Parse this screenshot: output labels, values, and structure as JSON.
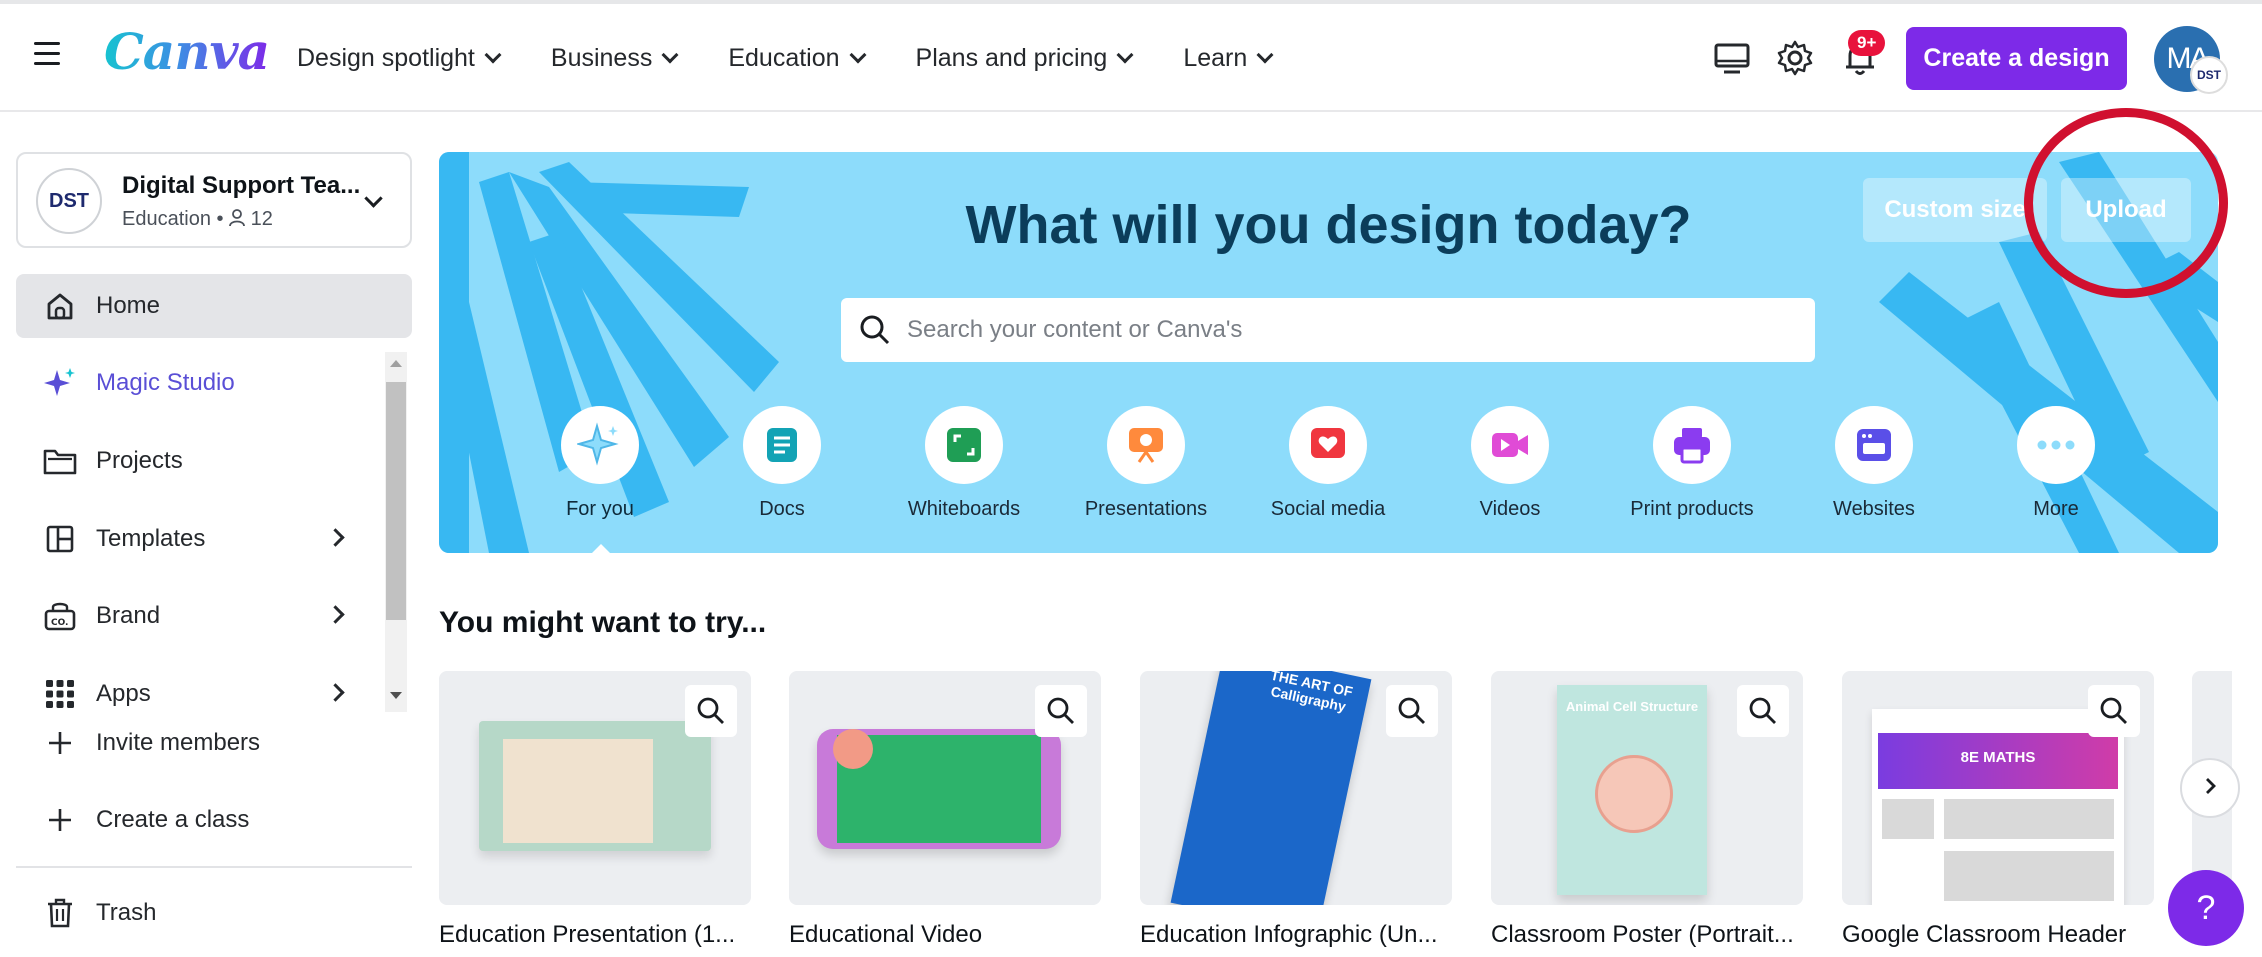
{
  "header": {
    "logo": "Canva",
    "nav": [
      {
        "label": "Design spotlight"
      },
      {
        "label": "Business"
      },
      {
        "label": "Education"
      },
      {
        "label": "Plans and pricing"
      },
      {
        "label": "Learn"
      }
    ],
    "notification_count": "9+",
    "create_label": "Create a design",
    "avatar_initials": "MA",
    "avatar_badge": "DST"
  },
  "sidebar": {
    "team": {
      "logo_text": "DST",
      "name": "Digital Support Tea...",
      "type": "Education",
      "members": "12"
    },
    "items": [
      {
        "label": "Home"
      },
      {
        "label": "Magic Studio"
      },
      {
        "label": "Projects"
      },
      {
        "label": "Templates"
      },
      {
        "label": "Brand"
      },
      {
        "label": "Apps"
      },
      {
        "label": "Invite members"
      },
      {
        "label": "Create a class"
      },
      {
        "label": "Trash"
      }
    ]
  },
  "hero": {
    "title": "What will you design today?",
    "search_placeholder": "Search your content or Canva's",
    "custom_size_label": "Custom size",
    "upload_label": "Upload",
    "categories": [
      {
        "label": "For you"
      },
      {
        "label": "Docs"
      },
      {
        "label": "Whiteboards"
      },
      {
        "label": "Presentations"
      },
      {
        "label": "Social media"
      },
      {
        "label": "Videos"
      },
      {
        "label": "Print products"
      },
      {
        "label": "Websites"
      },
      {
        "label": "More"
      }
    ]
  },
  "suggestions": {
    "title": "You might want to try...",
    "cards": [
      {
        "title": "Education Presentation (1..."
      },
      {
        "title": "Educational Video"
      },
      {
        "title": "Education Infographic (Un..."
      },
      {
        "title": "Classroom Poster (Portrait..."
      },
      {
        "title": "Google Classroom Header"
      }
    ],
    "thumb_texts": {
      "calligraphy": "THE ART OF Calligraphy",
      "cell": "Animal Cell Structure",
      "maths": "8E MATHS"
    }
  },
  "colors": {
    "brand_purple": "#7d2ae8",
    "hero_bg": "#8ddcfb",
    "annotation_red": "#d0102f"
  },
  "help_label": "?"
}
